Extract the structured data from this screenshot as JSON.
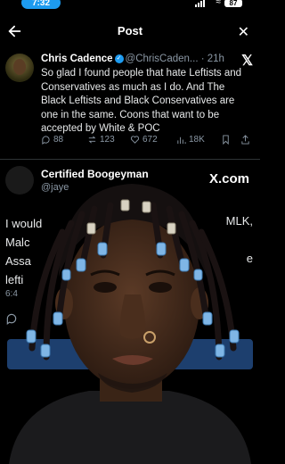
{
  "status_bar": {
    "time": "7:32",
    "battery": "87"
  },
  "header": {
    "title": "Post"
  },
  "tweet": {
    "name": "Chris Cadence",
    "handle": "@ChrisCaden...",
    "age": "21h",
    "text": "So glad I found people that hate Leftists and Conservatives as much as I do. And The Black Leftists and Black Conservatives are one in the same. Coons that want to be accepted by White & POC",
    "stats": {
      "replies": "88",
      "reposts": "123",
      "likes": "672",
      "views": "18K"
    }
  },
  "quoted": {
    "name": "Certified Boogeyman",
    "handle": "@jaye",
    "lines": [
      "I would",
      "Malc",
      "Assa",
      "lefti"
    ],
    "right_fragments": [
      "MLK,",
      "e"
    ],
    "time": "6:4"
  },
  "watermark": "X.com",
  "colors": {
    "accent": "#1d9bf0",
    "background": "#000000",
    "muted": "#8b98a5"
  }
}
